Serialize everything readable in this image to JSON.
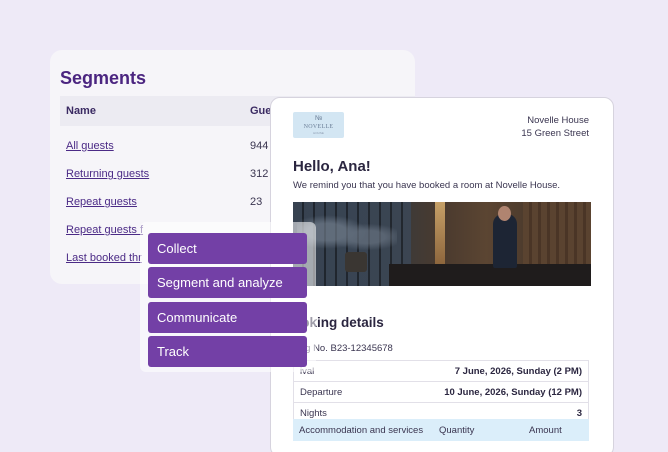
{
  "segments": {
    "title": "Segments",
    "headers": [
      "Name",
      "Gue"
    ],
    "rows": [
      {
        "name": "All guests",
        "count": "944"
      },
      {
        "name": "Returning guests",
        "count": "312"
      },
      {
        "name": "Repeat guests",
        "count": "23"
      },
      {
        "name": "Repeat guests f",
        "count": ""
      },
      {
        "name": "Last booked thr",
        "count": ""
      }
    ]
  },
  "menu": {
    "items": [
      "Collect",
      "Segment and analyze",
      "Communicate",
      "Track"
    ]
  },
  "email": {
    "logo": {
      "text": "NOVELLE",
      "subtext": "HOUSE"
    },
    "address": {
      "line1": "Novelle House",
      "line2": "15 Green Street"
    },
    "greeting": "Hello, Ana!",
    "message": "We remind you that you have booked a room at Novelle House.",
    "booking_title": "ooking details",
    "booking_number": "king No. B23-12345678",
    "details": [
      {
        "label": "ival",
        "value": "7 June, 2026, Sunday (2 PM)"
      },
      {
        "label": "Departure",
        "value": "10 June, 2026, Sunday (12 PM)"
      },
      {
        "label": "Nights",
        "value": "3"
      }
    ],
    "services_header": [
      "Accommodation and services",
      "Quantity",
      "Amount"
    ]
  },
  "colors": {
    "background": "#eeeaf7",
    "accent": "#7340a6",
    "title": "#4b2580",
    "link": "#4b2a86",
    "table_header": "#dbeefa"
  },
  "icons": [
    "hotel-logo-icon"
  ]
}
